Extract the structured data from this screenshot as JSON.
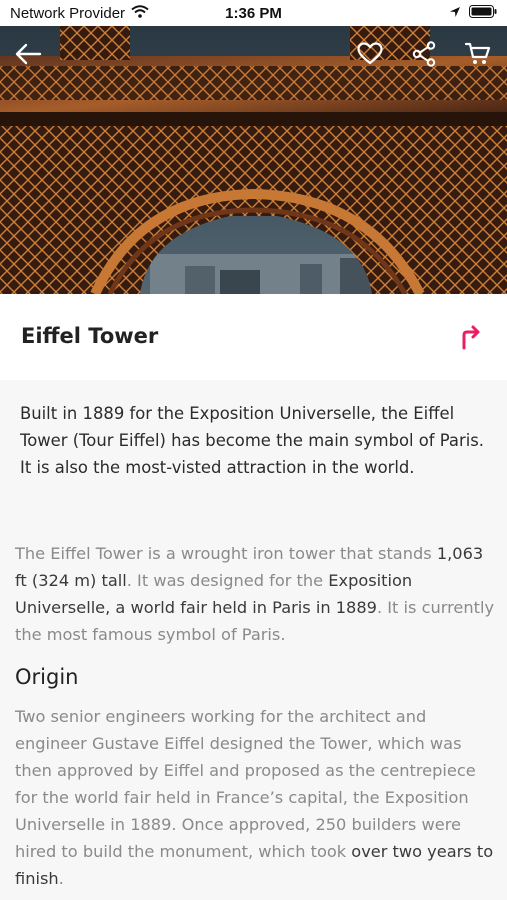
{
  "status_bar": {
    "carrier": "Network Provider",
    "time": "1:36 PM"
  },
  "icons": {
    "back": "arrow-left-icon",
    "favorite": "heart-icon",
    "share": "share-icon",
    "cart": "cart-icon",
    "directions": "turn-right-arrow-icon"
  },
  "colors": {
    "accent": "#e91e63"
  },
  "place": {
    "title": "Eiffel Tower",
    "intro": "Built in 1889 for the Exposition Universelle, the Eiffel Tower (Tour Eiffel) has become the main symbol of Paris. It is also the most-visted attraction in the world.",
    "desc_1": "The Eiffel Tower is a wrought iron tower that stands ",
    "desc_2": "1,063 ft (324 m) tall",
    "desc_3": ". It was designed for the ",
    "desc_4": "Exposition Universelle, a world fair held in Paris in 1889",
    "desc_5": ". It is currently the most famous symbol of Paris.",
    "origin_heading": "Origin",
    "origin_1": "Two senior engineers working for the architect and engineer Gustave Eiffel designed the Tower, which was then approved by Eiffel and proposed as the centrepiece for the world fair held in France’s capital, the Exposition Universelle in 1889. Once approved, 250 builders were hired to build the monument, which took ",
    "origin_2": "over two years to finish",
    "origin_3": "."
  }
}
